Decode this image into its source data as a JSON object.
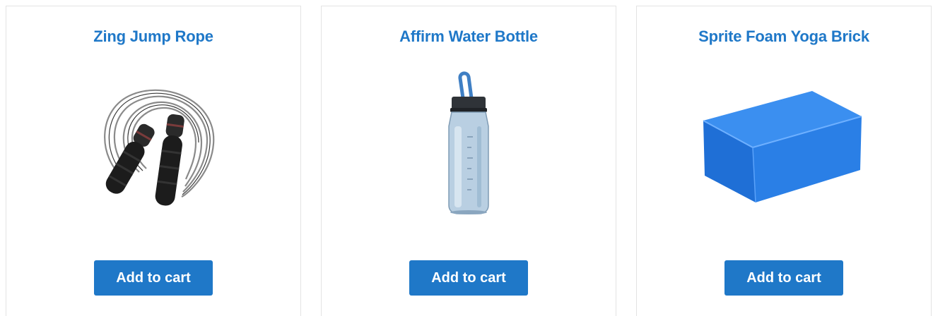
{
  "products": [
    {
      "name": "Zing Jump Rope",
      "image_icon": "jump-rope-image",
      "button_label": "Add to cart"
    },
    {
      "name": "Affirm Water Bottle",
      "image_icon": "water-bottle-image",
      "button_label": "Add to cart"
    },
    {
      "name": "Sprite Foam Yoga Brick",
      "image_icon": "yoga-brick-image",
      "button_label": "Add to cart"
    }
  ],
  "colors": {
    "accent": "#1f78c8",
    "card_border": "#e3e3e3",
    "brick_blue": "#1f7be6"
  }
}
